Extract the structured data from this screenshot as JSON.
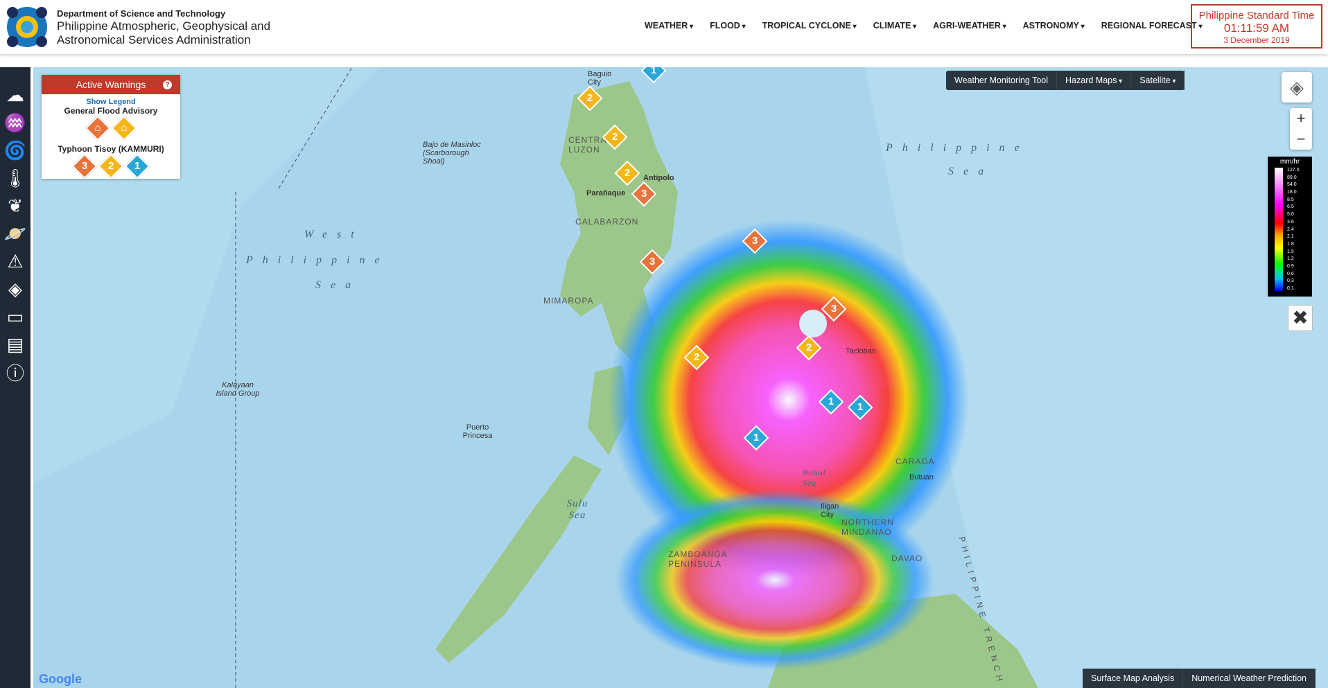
{
  "header": {
    "dept": "Department of Science and Technology",
    "name_line1": "Philippine Atmospheric, Geophysical and",
    "name_line2": "Astronomical Services Administration",
    "nav": [
      "WEATHER",
      "FLOOD",
      "TROPICAL CYCLONE",
      "CLIMATE",
      "AGRI-WEATHER",
      "ASTRONOMY",
      "REGIONAL FORECAST"
    ],
    "pst_label": "Philippine Standard Time",
    "pst_time": "01:11:59 AM",
    "pst_date": "3 December 2019"
  },
  "sidebar": {
    "icons": [
      "weather-icon",
      "flood-icon",
      "cyclone-icon",
      "thermometer-icon",
      "agri-icon",
      "planet-icon",
      "hazard-icon",
      "layers-icon",
      "vacancy-icon",
      "document-icon",
      "info-icon"
    ]
  },
  "warnings": {
    "title": "Active Warnings",
    "help": "?",
    "show_legend": "Show Legend",
    "flood_title": "General Flood Advisory",
    "typhoon_title": "Typhoon Tisoy (KAMMURI)",
    "signals": [
      "3",
      "2",
      "1"
    ]
  },
  "toolbar": {
    "items": [
      "Weather Monitoring Tool",
      "Hazard Maps",
      "Satellite"
    ]
  },
  "scale": {
    "unit": "mm/hr",
    "values": [
      "127.0",
      "89.0",
      "54.0",
      "18.0",
      "8.5",
      "6.5",
      "5.0",
      "3.6",
      "2.4",
      "2.1",
      "1.8",
      "1.5",
      "1.2",
      "0.9",
      "0.6",
      "0.3",
      "0.1"
    ]
  },
  "map_labels": {
    "ps1": "Philippine",
    "ps2": "Sea",
    "wps1": "West",
    "wps2": "Philippine",
    "wps3": "Sea",
    "sulu": "Sulu Sea",
    "bohol": "Bohol Sea",
    "trench": "PHILIPPINE TRENCH",
    "scarborough": "Bajo de Masinloc (Scarborough Shoal)",
    "kalayaan": "Kalayaan Island Group",
    "mimaropa": "MIMAROPA",
    "calabarzon": "CALABARZON",
    "puerto": "Puerto Princesa",
    "caraga": "CARAGA",
    "northern_mindanao": "NORTHERN MINDANAO",
    "zamboanga": "ZAMBOANGA PENINSULA",
    "davao": "DAVAO",
    "tacloban": "Tacloban",
    "baguio": "Baguio City",
    "antipolo": "Antipolo",
    "paranaque": "Parañaque",
    "central_luzon": "CENTRAL LUZON",
    "butuan": "Butuan",
    "iligan": "Iligan City"
  },
  "bottom": {
    "items": [
      "Surface Map Analysis",
      "Numerical Weather Prediction"
    ]
  },
  "google": "Google"
}
